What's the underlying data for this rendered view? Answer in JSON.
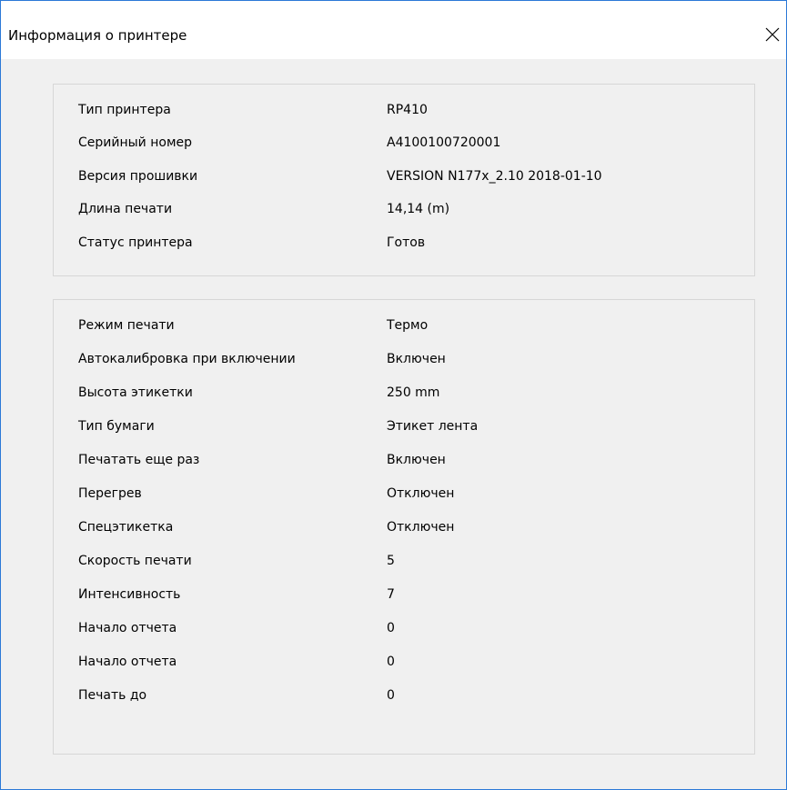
{
  "window": {
    "title": "Информация о принтере",
    "close_icon": "close-icon"
  },
  "printer_info": [
    {
      "label": "Тип принтера",
      "value": "RP410"
    },
    {
      "label": "Серийный номер",
      "value": "A4100100720001"
    },
    {
      "label": "Версия прошивки",
      "value": "VERSION N177x_2.10 2018-01-10"
    },
    {
      "label": "Длина печати",
      "value": "14,14 (m)"
    },
    {
      "label": "Статус принтера",
      "value": "Готов"
    }
  ],
  "settings": [
    {
      "label": "Режим печати",
      "value": "Термо"
    },
    {
      "label": "Автокалибровка при включении",
      "value": "Включен"
    },
    {
      "label": "Высота этикетки",
      "value": "250 mm"
    },
    {
      "label": "Тип бумаги",
      "value": "Этикет лента"
    },
    {
      "label": "Печатать еще раз",
      "value": "Включен"
    },
    {
      "label": "Перегрев",
      "value": "Отключен"
    },
    {
      "label": "Спецэтикетка",
      "value": "Отключен"
    },
    {
      "label": "Скорость печати",
      "value": "5"
    },
    {
      "label": "Интенсивность",
      "value": "7"
    },
    {
      "label": "Начало отчета",
      "value": "0"
    },
    {
      "label": "Начало отчета",
      "value": "0"
    },
    {
      "label": "Печать до",
      "value": "0"
    }
  ]
}
